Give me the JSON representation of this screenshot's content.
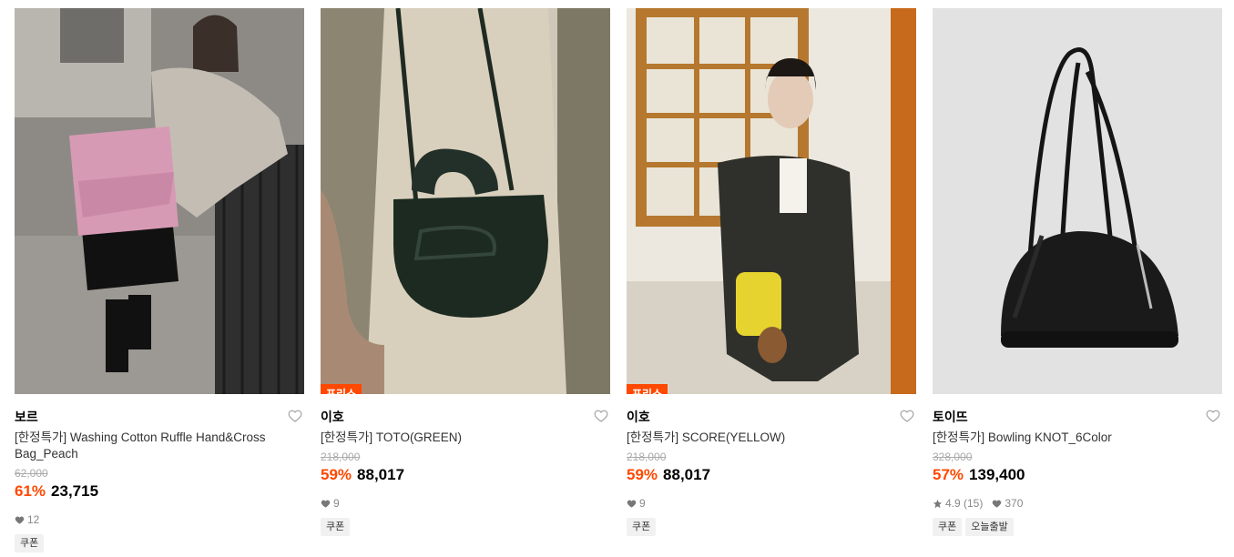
{
  "products": [
    {
      "brand": "보르",
      "badge": "",
      "name": "[한정특가] Washing Cotton Ruffle Hand&Cross Bag_Peach",
      "original_price": "62,000",
      "discount": "61%",
      "price": "23,715",
      "rating": "",
      "likes": "12",
      "tags": [
        "쿠폰"
      ],
      "image_icon": "model-with-pink-ruffle-bag"
    },
    {
      "brand": "이호",
      "badge": "프리쇼",
      "name": "[한정특가] TOTO(GREEN)",
      "original_price": "218,000",
      "discount": "59%",
      "price": "88,017",
      "rating": "",
      "likes": "9",
      "tags": [
        "쿠폰"
      ],
      "image_icon": "green-crossbody-bag"
    },
    {
      "brand": "이호",
      "badge": "프리쇼",
      "name": "[한정특가] SCORE(YELLOW)",
      "original_price": "218,000",
      "discount": "59%",
      "price": "88,017",
      "rating": "",
      "likes": "9",
      "tags": [
        "쿠폰"
      ],
      "image_icon": "model-with-yellow-bucket-bag"
    },
    {
      "brand": "토이뜨",
      "badge": "",
      "name": "[한정특가] Bowling KNOT_6Color",
      "original_price": "328,000",
      "discount": "57%",
      "price": "139,400",
      "rating": "4.9 (15)",
      "likes": "370",
      "tags": [
        "쿠폰",
        "오늘출발"
      ],
      "image_icon": "black-bowling-bag"
    }
  ],
  "colors": {
    "accent": "#ff4800",
    "muted": "#888888",
    "tag_bg": "#f1f1f1"
  }
}
